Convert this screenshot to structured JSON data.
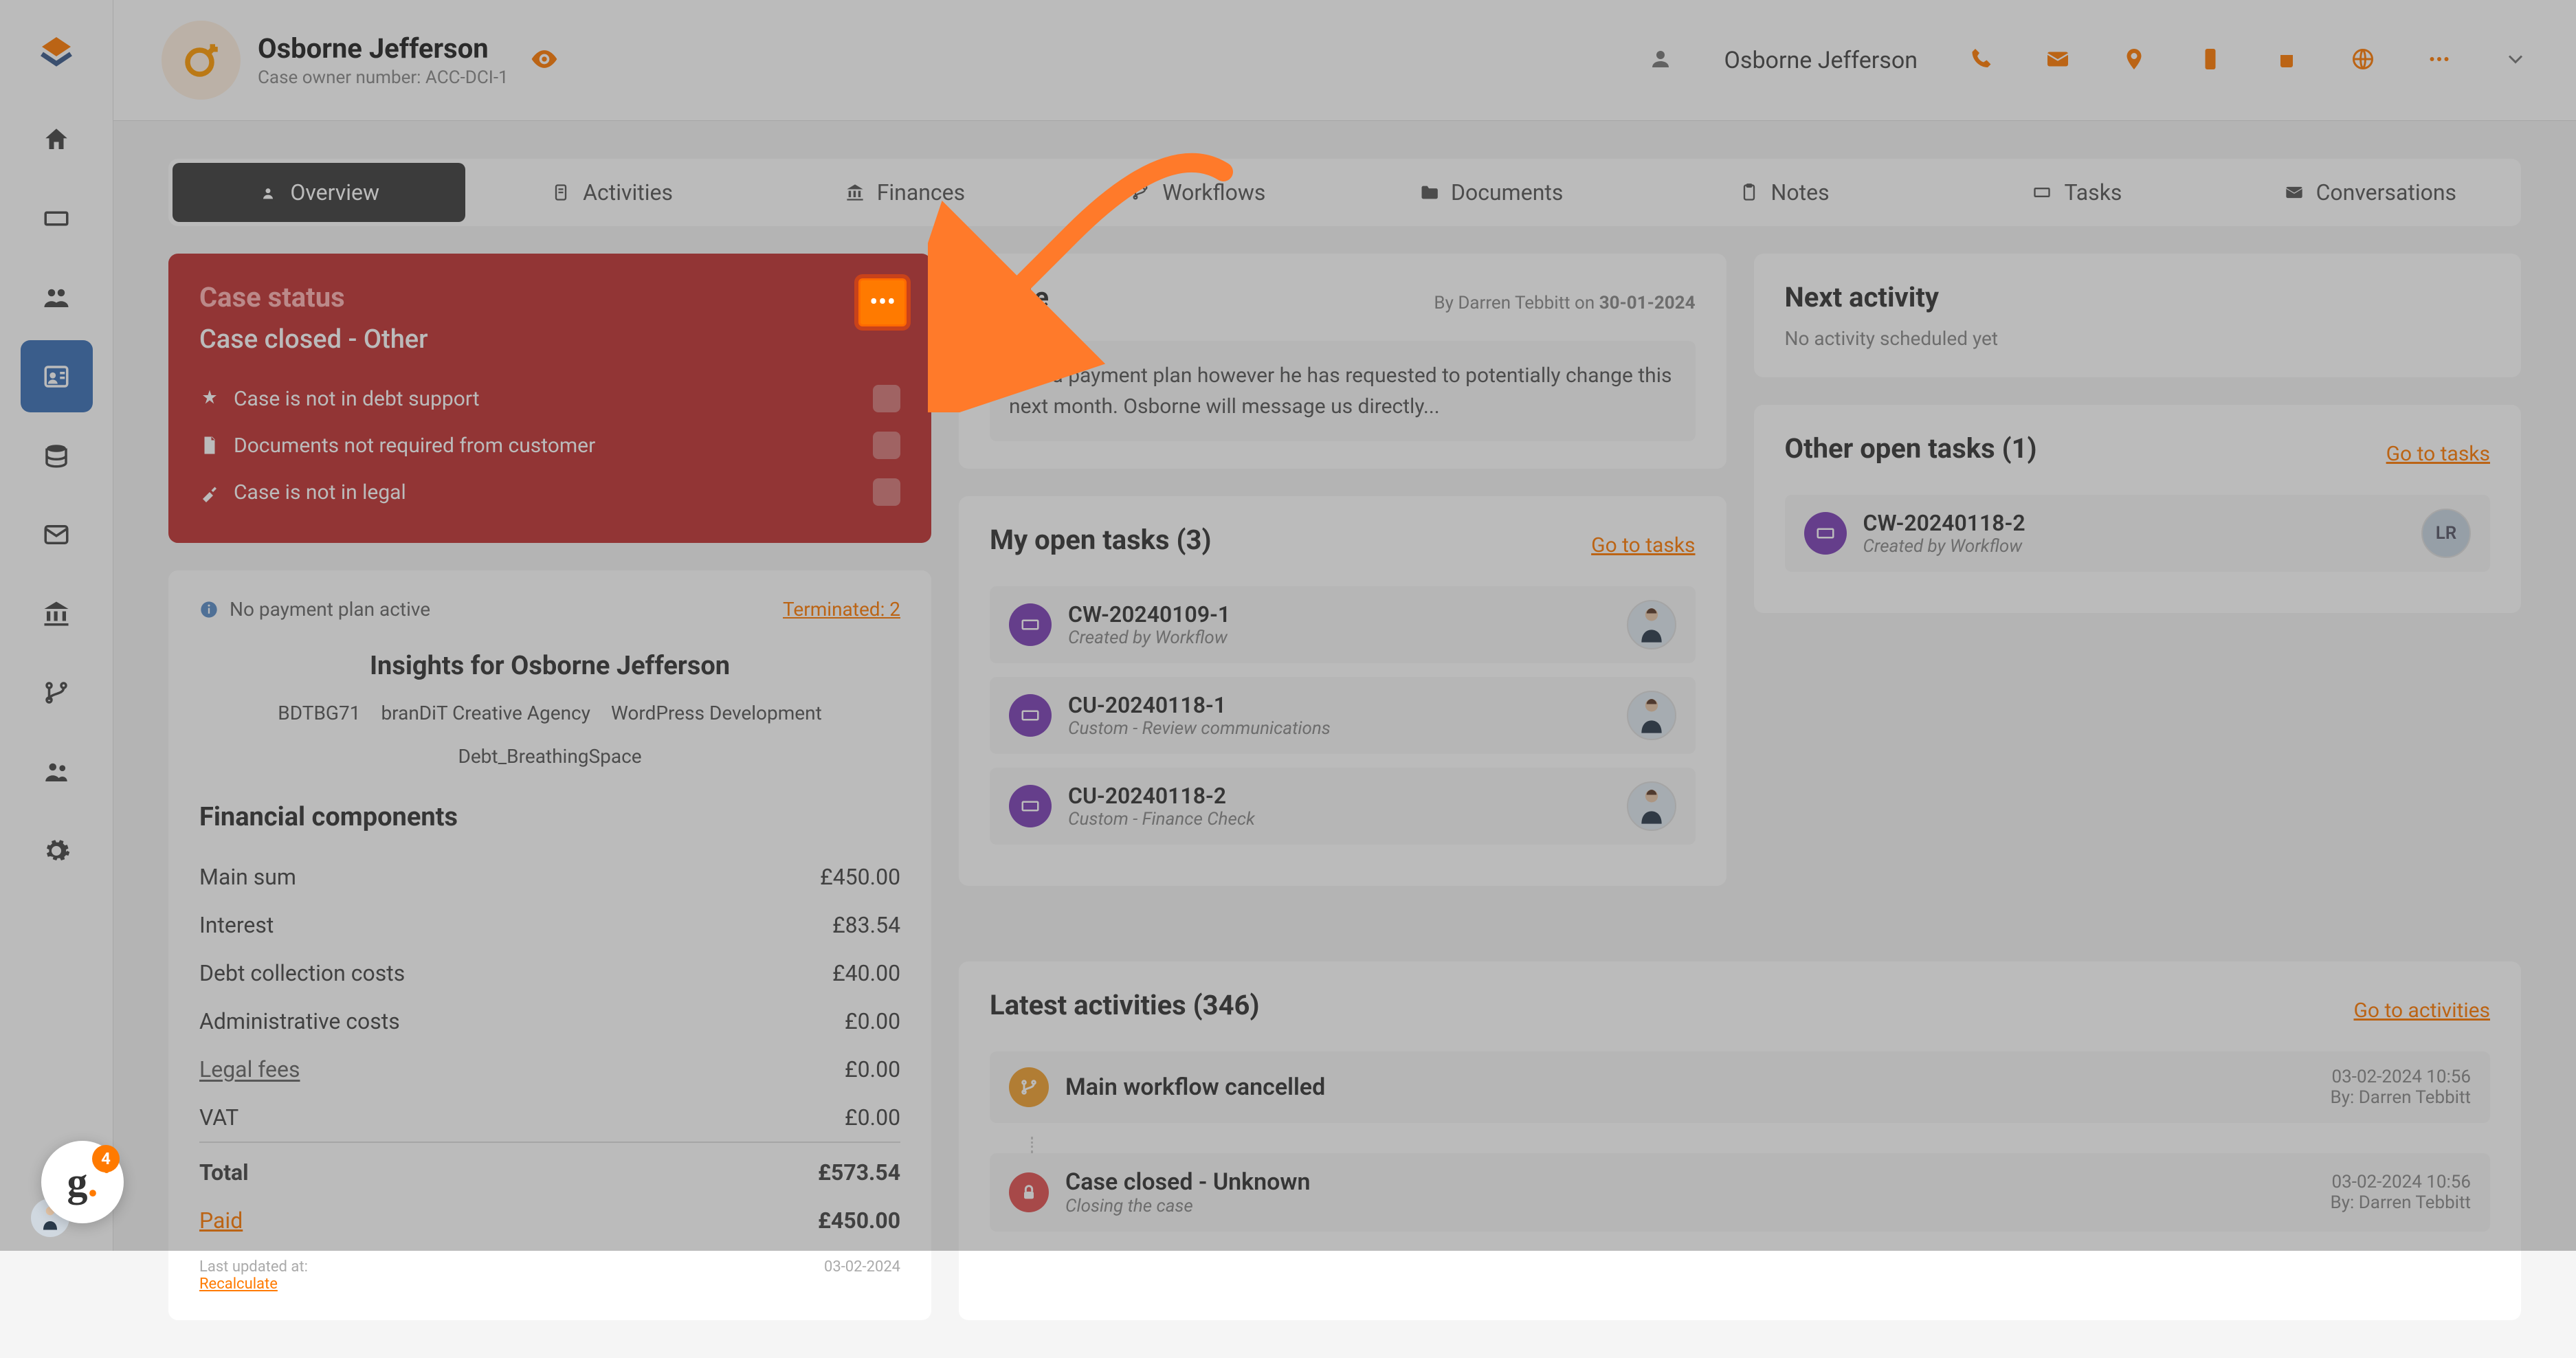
{
  "header": {
    "person_name": "Osborne Jefferson",
    "case_owner_label": "Case owner number: ACC-DCI-1",
    "user_display": "Osborne Jefferson"
  },
  "tabs": {
    "overview": "Overview",
    "activities": "Activities",
    "finances": "Finances",
    "workflows": "Workflows",
    "documents": "Documents",
    "notes": "Notes",
    "tasks": "Tasks",
    "conversations": "Conversations"
  },
  "case_status": {
    "title": "Case status",
    "closed": "Case closed - Other",
    "r1": "Case is not in debt support",
    "r2": "Documents not required from customer",
    "r3": "Case is not in legal"
  },
  "note": {
    "title": "Note",
    "by_prefix": "By Darren Tebbitt on",
    "date": "30-01-2024",
    "body": "Is in a payment plan however he has requested to potentially change this next month. Osborne will message us directly..."
  },
  "next_activity": {
    "title": "Next activity",
    "empty": "No activity scheduled yet"
  },
  "payment": {
    "warn": "No payment plan active",
    "terminated": "Terminated: 2"
  },
  "insights": {
    "title": "Insights for Osborne Jefferson",
    "tags": [
      "BDTBG71",
      "branDiT Creative Agency",
      "WordPress Development",
      "Debt_BreathingSpace"
    ]
  },
  "fin": {
    "title": "Financial components",
    "rows": [
      {
        "label": "Main sum",
        "val": "£450.00"
      },
      {
        "label": "Interest",
        "val": "£83.54"
      },
      {
        "label": "Debt collection costs",
        "val": "£40.00"
      },
      {
        "label": "Administrative costs",
        "val": "£0.00"
      },
      {
        "label": "Legal fees",
        "val": "£0.00"
      },
      {
        "label": "VAT",
        "val": "£0.00"
      }
    ],
    "total_label": "Total",
    "total_val": "£573.54",
    "paid_label": "Paid",
    "paid_val": "£450.00",
    "updated_label": "Last updated at:",
    "updated_val": "03-02-2024",
    "recalc": "Recalculate"
  },
  "my_tasks": {
    "title": "My open tasks (3)",
    "link": "Go to tasks",
    "items": [
      {
        "id": "CW-20240109-1",
        "sub": "Created by Workflow"
      },
      {
        "id": "CU-20240118-1",
        "sub": "Custom - Review communications"
      },
      {
        "id": "CU-20240118-2",
        "sub": "Custom - Finance Check"
      }
    ]
  },
  "other_tasks": {
    "title": "Other open tasks (1)",
    "link": "Go to tasks",
    "items": [
      {
        "id": "CW-20240118-2",
        "sub": "Created by Workflow",
        "initials": "LR"
      }
    ]
  },
  "activities": {
    "title": "Latest activities (346)",
    "link": "Go to activities",
    "items": [
      {
        "title": "Main workflow cancelled",
        "sub": "",
        "time": "03-02-2024 10:56",
        "by": "By: Darren Tebbitt",
        "kind": "branch"
      },
      {
        "title": "Case closed - Unknown",
        "sub": "Closing the case",
        "time": "03-02-2024 10:56",
        "by": "By: Darren Tebbitt",
        "kind": "lock"
      }
    ]
  },
  "corner_badge": "4"
}
